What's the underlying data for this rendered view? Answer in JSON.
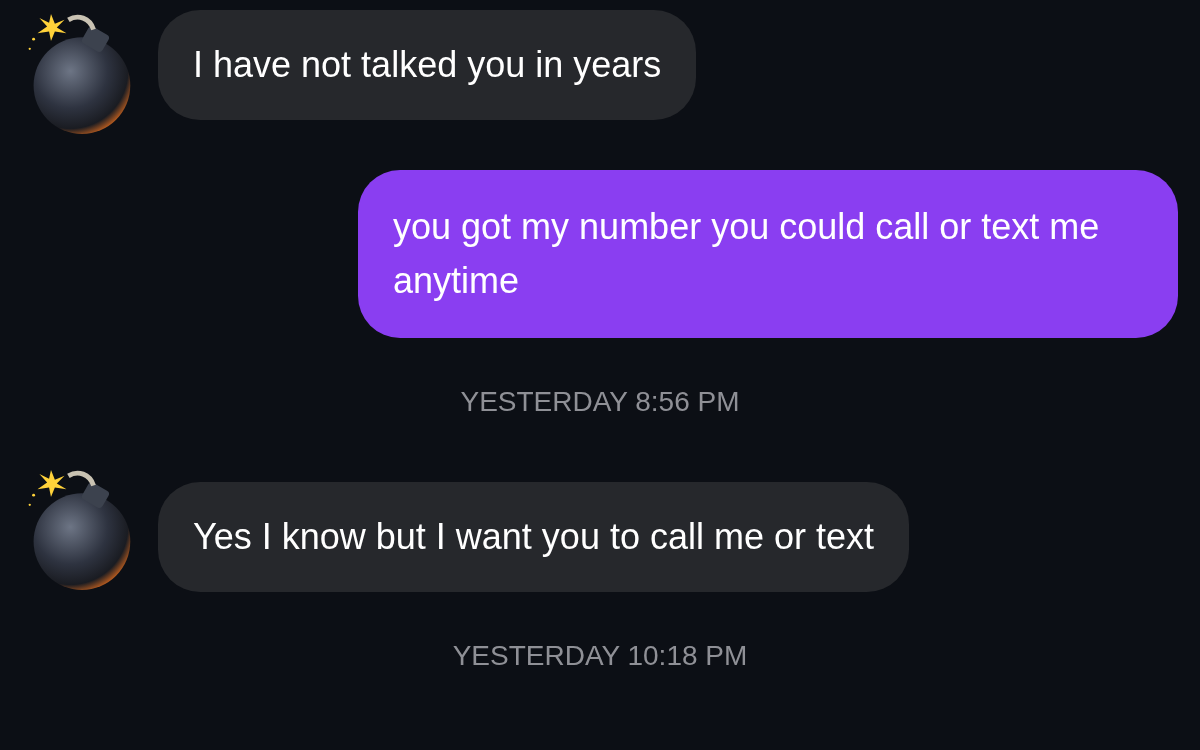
{
  "messages": [
    {
      "kind": "received",
      "text": "I have not talked you in years"
    },
    {
      "kind": "sent",
      "text": "you got my number you could call or text me anytime"
    },
    {
      "kind": "timestamp",
      "day": "YESTERDAY",
      "time": "8:56 PM"
    },
    {
      "kind": "received",
      "text": "Yes I know but I want you to call me or text"
    },
    {
      "kind": "timestamp",
      "day": "YESTERDAY",
      "time": "10:18 PM"
    }
  ]
}
